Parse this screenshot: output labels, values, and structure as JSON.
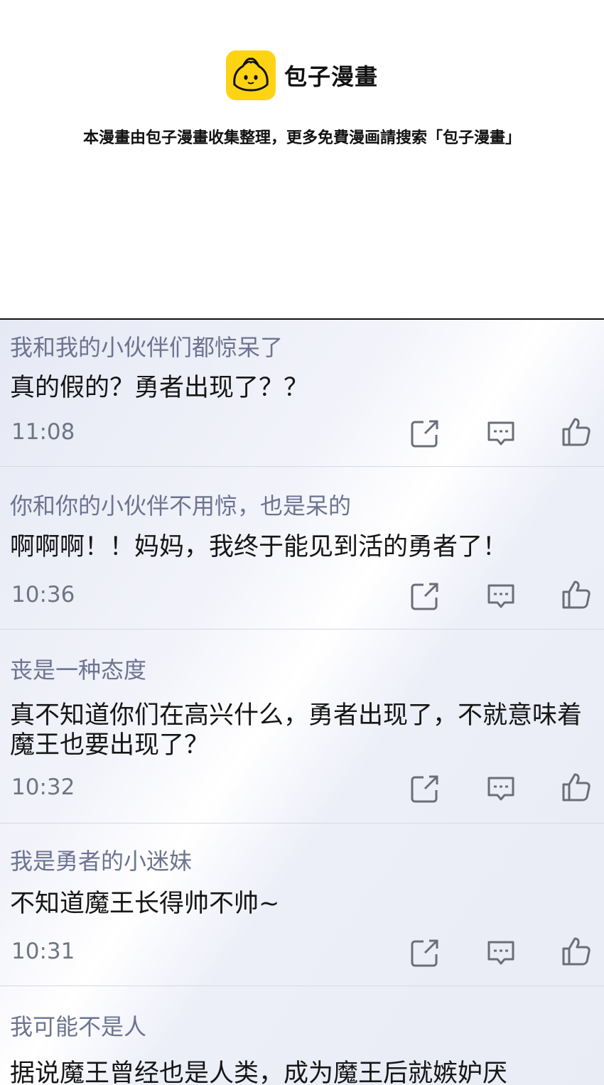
{
  "brand": {
    "name": "包子漫畫",
    "logo_icon": "bun-mascot-icon",
    "logo_color": "#fdd314"
  },
  "notice": "本漫畫由包子漫畫收集整理，更多免費漫画請搜索「包子漫畫」",
  "comments": [
    {
      "user": "我和我的小伙伴们都惊呆了",
      "text": "真的假的？勇者出现了？？",
      "time": "11:08"
    },
    {
      "user": "你和你的小伙伴不用惊，也是呆的",
      "text": "啊啊啊！！妈妈，我终于能见到活的勇者了！",
      "time": "10:36"
    },
    {
      "user": "丧是一种态度",
      "text": "真不知道你们在高兴什么，勇者出现了，不就意味着魔王也要出现了？",
      "time": "10:32"
    },
    {
      "user": "我是勇者的小迷妹",
      "text": "不知道魔王长得帅不帅~",
      "time": "10:31"
    },
    {
      "user": "我可能不是人",
      "text": "据说魔王曾经也是人类，成为魔王后就嫉妒厌",
      "time": ""
    }
  ],
  "actions": {
    "share_icon": "share-icon",
    "reply_icon": "reply-icon",
    "like_icon": "like-icon"
  }
}
